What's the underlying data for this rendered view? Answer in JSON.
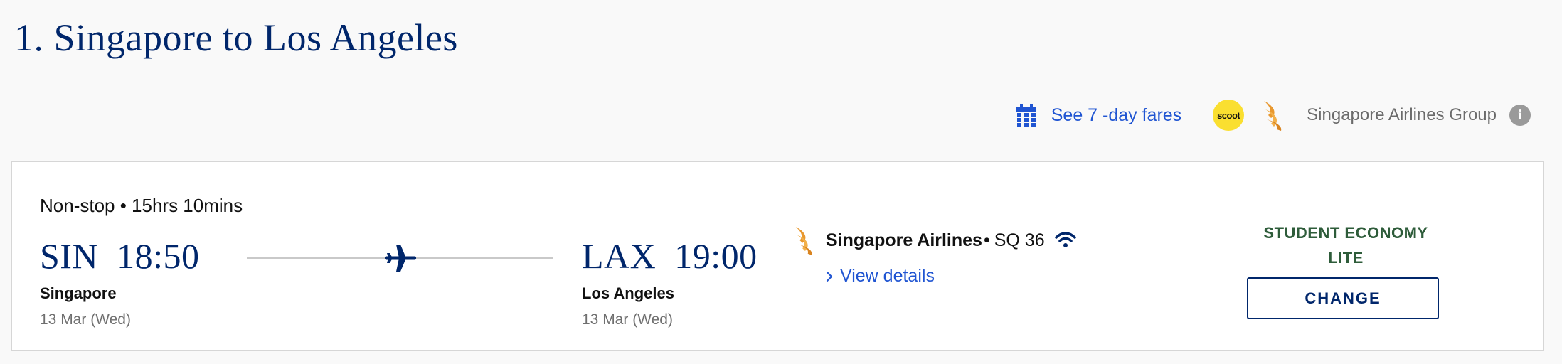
{
  "section": {
    "title": "1. Singapore to Los Angeles"
  },
  "toolbar": {
    "seven_day_fares_label": "See 7 -day fares",
    "scoot_badge_text": "scoot",
    "airline_group_label": "Singapore Airlines Group",
    "info_icon_glyph": "i"
  },
  "flight": {
    "summary": "Non-stop • 15hrs 10mins",
    "departure": {
      "code_time": "SIN  18:50",
      "city": "Singapore",
      "date": "13 Mar (Wed)"
    },
    "arrival": {
      "code_time": "LAX  19:00",
      "city": "Los Angeles",
      "date": "13 Mar (Wed)"
    },
    "operator": {
      "airline": "Singapore Airlines",
      "separator": "•",
      "flight_number": "SQ 36",
      "view_details_label": "View details"
    },
    "fare": {
      "name_line1": "STUDENT ECONOMY",
      "name_line2": "LITE",
      "change_label": "CHANGE"
    }
  },
  "colors": {
    "navy": "#00266b",
    "link_blue": "#2055d2",
    "fare_green": "#2e5c3a",
    "scoot_yellow": "#fadf30",
    "sq_gold": "#e8982f"
  },
  "icons": [
    "calendar-icon",
    "scoot-logo",
    "singapore-airlines-logo",
    "info-icon",
    "plane-icon",
    "wifi-icon",
    "chevron-right-icon"
  ]
}
